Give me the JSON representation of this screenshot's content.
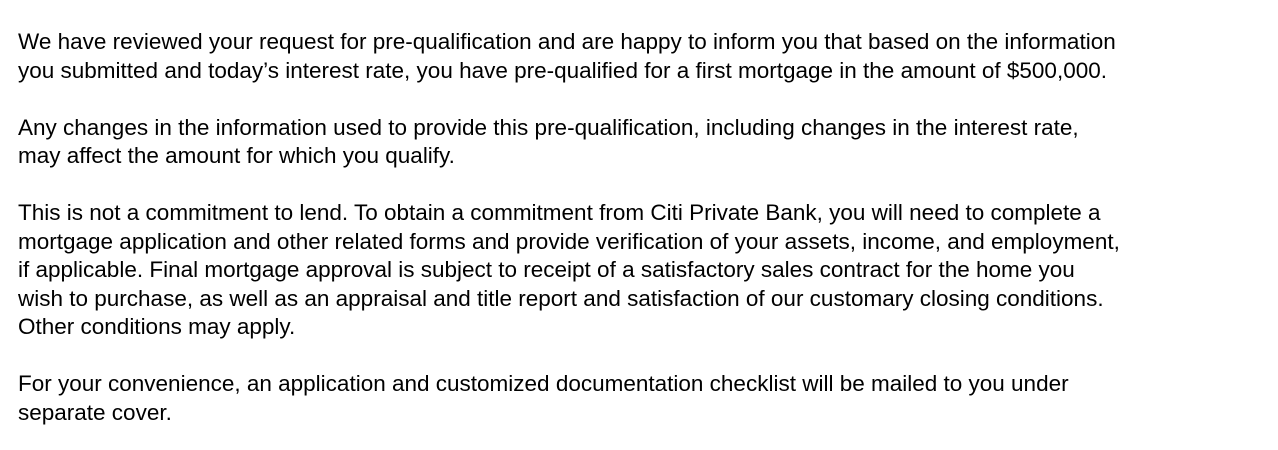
{
  "letter": {
    "paragraphs": [
      {
        "lines": [
          "We have reviewed your request for pre-qualification and are happy to inform you that based on the information",
          "you submitted and today’s interest rate, you have pre-qualified for a first mortgage in the amount of $500,000."
        ]
      },
      {
        "lines": [
          "Any changes in the information used to provide this pre-qualification, including changes in the interest rate,",
          "may affect the amount for which you qualify."
        ]
      },
      {
        "lines": [
          "This is not a commitment to lend. To obtain a commitment from Citi Private Bank, you will need to complete a",
          "mortgage application and other related forms and provide verification of your assets, income, and employment,",
          "if applicable. Final mortgage approval is subject to receipt of a satisfactory sales contract for the home you",
          "wish to purchase, as well as an appraisal and title report and satisfaction of our customary closing conditions.",
          "Other conditions may apply."
        ]
      },
      {
        "lines": [
          "For your convenience, an application and customized documentation checklist will be mailed to you under",
          "separate cover."
        ]
      }
    ]
  }
}
